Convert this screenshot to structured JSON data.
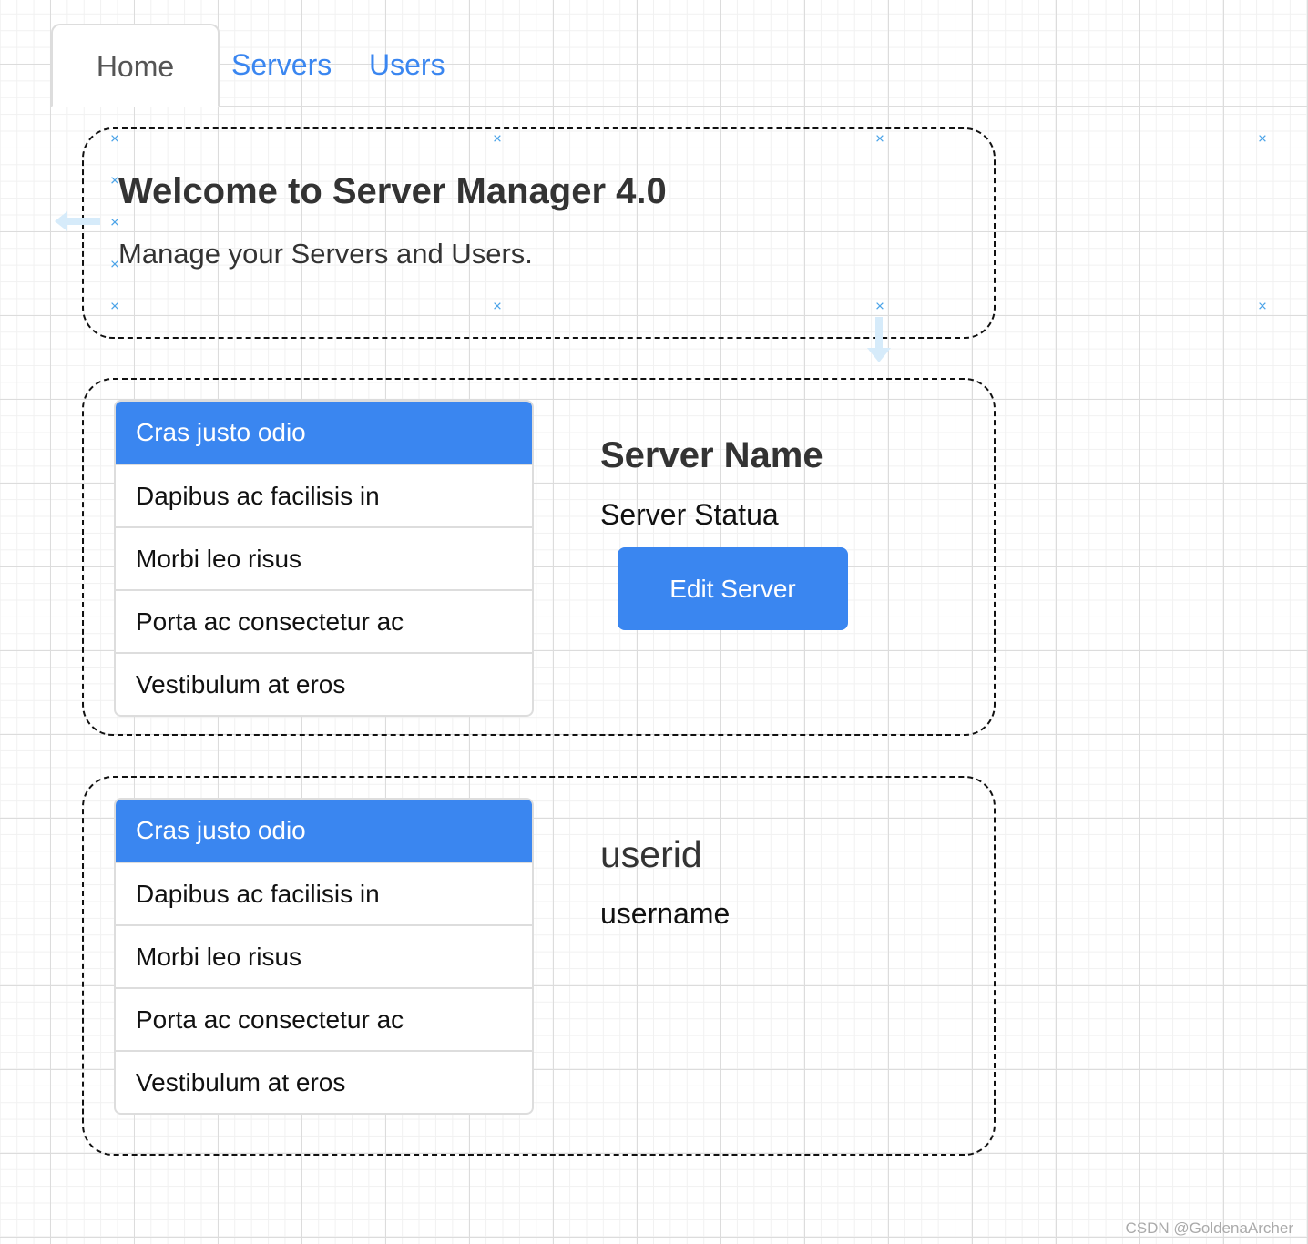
{
  "nav": {
    "tabs": [
      {
        "label": "Home",
        "active": true
      },
      {
        "label": "Servers",
        "active": false
      },
      {
        "label": "Users",
        "active": false
      }
    ]
  },
  "hero": {
    "title": "Welcome to Server Manager 4.0",
    "subtitle": "Manage your Servers and Users."
  },
  "servers_section": {
    "list": [
      "Cras justo odio",
      "Dapibus ac facilisis in",
      "Morbi leo risus",
      "Porta ac consectetur ac",
      "Vestibulum at eros"
    ],
    "active_index": 0,
    "detail": {
      "name": "Server Name",
      "status": "Server Statua",
      "edit_button": "Edit Server"
    }
  },
  "users_section": {
    "list": [
      "Cras justo odio",
      "Dapibus ac facilisis in",
      "Morbi leo risus",
      "Porta ac consectetur ac",
      "Vestibulum at eros"
    ],
    "active_index": 0,
    "detail": {
      "userid": "userid",
      "username": "username"
    }
  },
  "handles": {
    "glyph": "×"
  },
  "colors": {
    "primary": "#3a86f0",
    "handle": "#4aa3e8",
    "border": "#dddddd"
  },
  "watermark": "CSDN @GoldenaArcher"
}
